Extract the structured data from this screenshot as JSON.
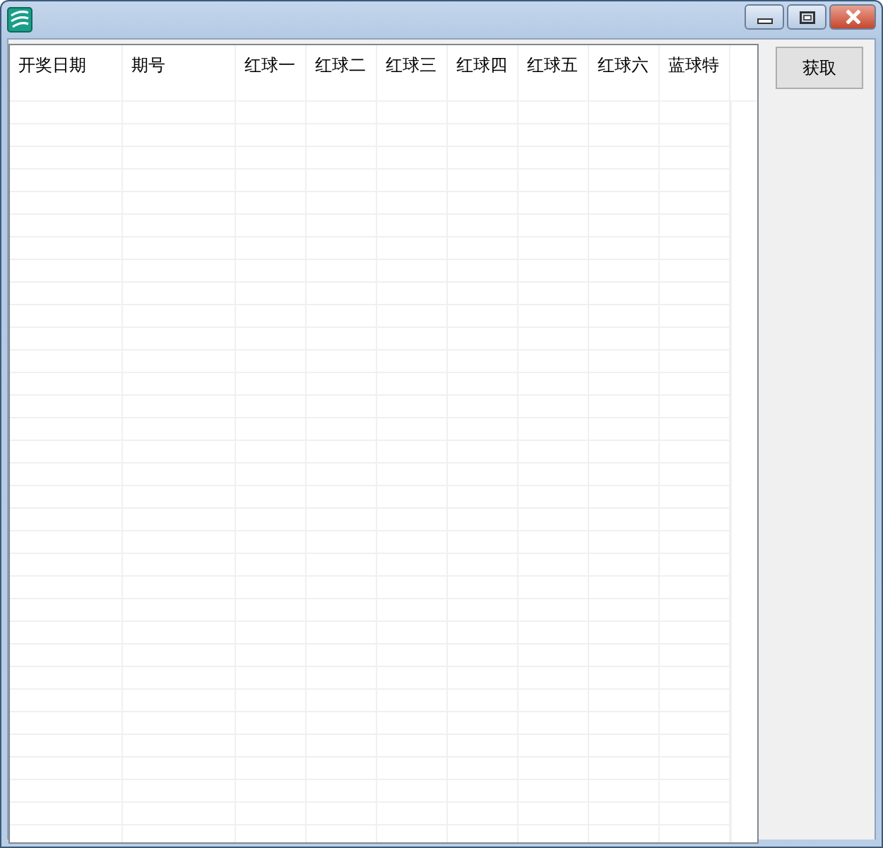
{
  "table": {
    "columns": [
      "开奖日期",
      "期号",
      "红球一",
      "红球二",
      "红球三",
      "红球四",
      "红球五",
      "红球六",
      "蓝球特"
    ]
  },
  "buttons": [
    "获取"
  ]
}
